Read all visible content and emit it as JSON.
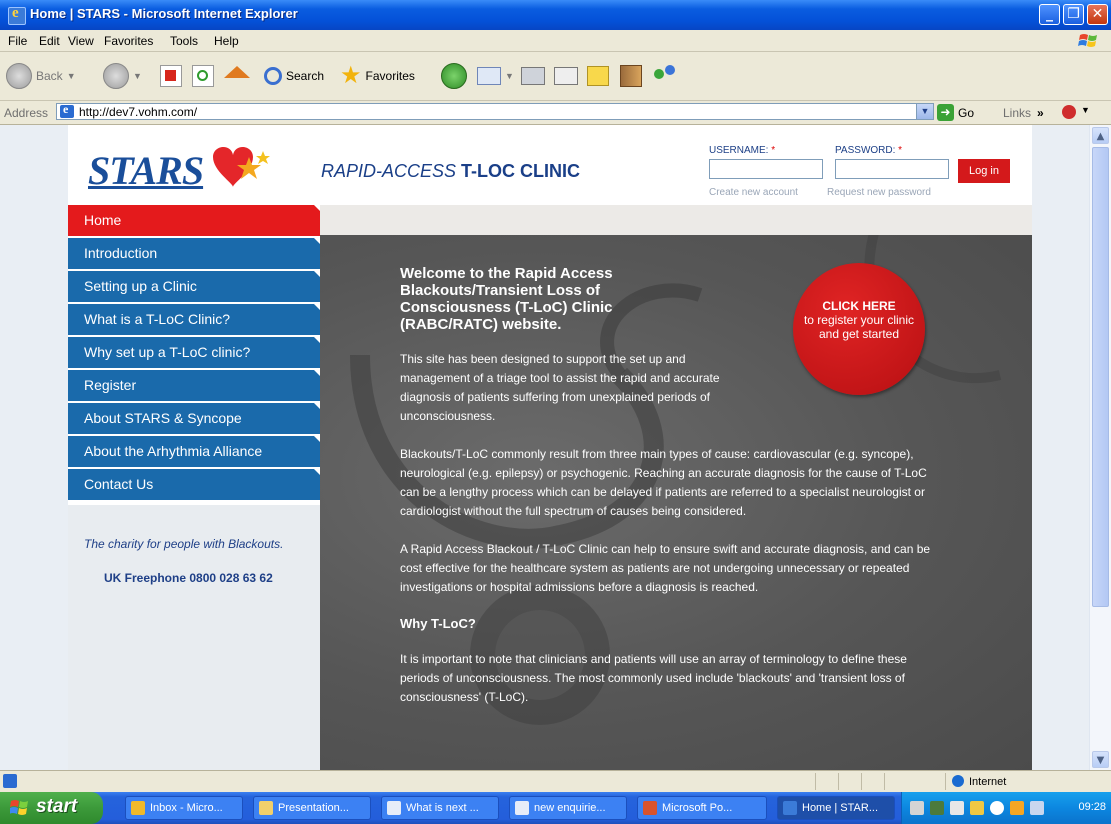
{
  "window": {
    "title": "Home | STARS - Microsoft Internet Explorer"
  },
  "menu": [
    "File",
    "Edit",
    "View",
    "Favorites",
    "Tools",
    "Help"
  ],
  "toolbar": {
    "back": "Back",
    "search": "Search",
    "favorites": "Favorites"
  },
  "address": {
    "label": "Address",
    "url": "http://dev7.vohm.com/",
    "go": "Go",
    "links": "Links",
    "chevrons": "»"
  },
  "site": {
    "logo_text": "STARS",
    "tagline_italic": "RAPID-ACCESS ",
    "tagline_bold": "T-LOC CLINIC",
    "login": {
      "username_label": "USERNAME:",
      "password_label": "PASSWORD:",
      "required_mark": "*",
      "login_button": "Log in",
      "create_account": "Create new account",
      "request_password": "Request new password"
    },
    "nav": [
      {
        "label": "Home",
        "active": true
      },
      {
        "label": "Introduction"
      },
      {
        "label": "Setting up a Clinic"
      },
      {
        "label": "What is a T-LoC Clinic?"
      },
      {
        "label": "Why set up a T-LoC clinic?"
      },
      {
        "label": "Register"
      },
      {
        "label": "About STARS & Syncope"
      },
      {
        "label": "About the Arhythmia Alliance"
      },
      {
        "label": "Contact Us"
      }
    ],
    "sidebar": {
      "charity": "The charity for people with Blackouts.",
      "phone": "UK Freephone 0800 028 63 62"
    },
    "cta": {
      "line1": "CLICK HERE",
      "line2": "to register your clinic and get started"
    },
    "content": {
      "heading": "Welcome to the Rapid Access Blackouts/Transient Loss of Consciousness (T-LoC) Clinic (RABC/RATC) website.",
      "p1": "This site has been designed to support the set up and management of a triage tool to assist the rapid and accurate diagnosis of patients suffering from unexplained periods of unconsciousness.",
      "p2": "Blackouts/T-LoC commonly result from three main types of cause: cardiovascular (e.g. syncope), neurological (e.g. epilepsy) or psychogenic. Reaching an accurate diagnosis for the cause of T-LoC can be a lengthy process which can be delayed if patients are referred to a specialist neurologist or cardiologist without the full spectrum of causes being considered.",
      "p3": "A Rapid Access Blackout / T-LoC Clinic can help to ensure swift and accurate diagnosis, and can be cost effective for the healthcare system as patients are not undergoing unnecessary or repeated investigations or hospital admissions before a diagnosis is reached.",
      "subheading": "Why T-LoC?",
      "p4": "It is important to note that clinicians and patients will use an array of terminology to define these periods of unconsciousness. The most commonly used include 'blackouts' and 'transient loss of consciousness' (T-LoC)."
    }
  },
  "status": {
    "zone": "Internet"
  },
  "taskbar": {
    "start": "start",
    "buttons": [
      {
        "label": "Inbox - Micro..."
      },
      {
        "label": "Presentation..."
      },
      {
        "label": "What is next ..."
      },
      {
        "label": "new enquirie..."
      },
      {
        "label": "Microsoft Po..."
      },
      {
        "label": "Home | STAR..."
      }
    ],
    "clock": "09:28"
  },
  "colors": {
    "nav_blue": "#1a6aab",
    "nav_active": "#e41a1c",
    "titlebar": "#0451d8",
    "cta_red": "#c8151a"
  }
}
